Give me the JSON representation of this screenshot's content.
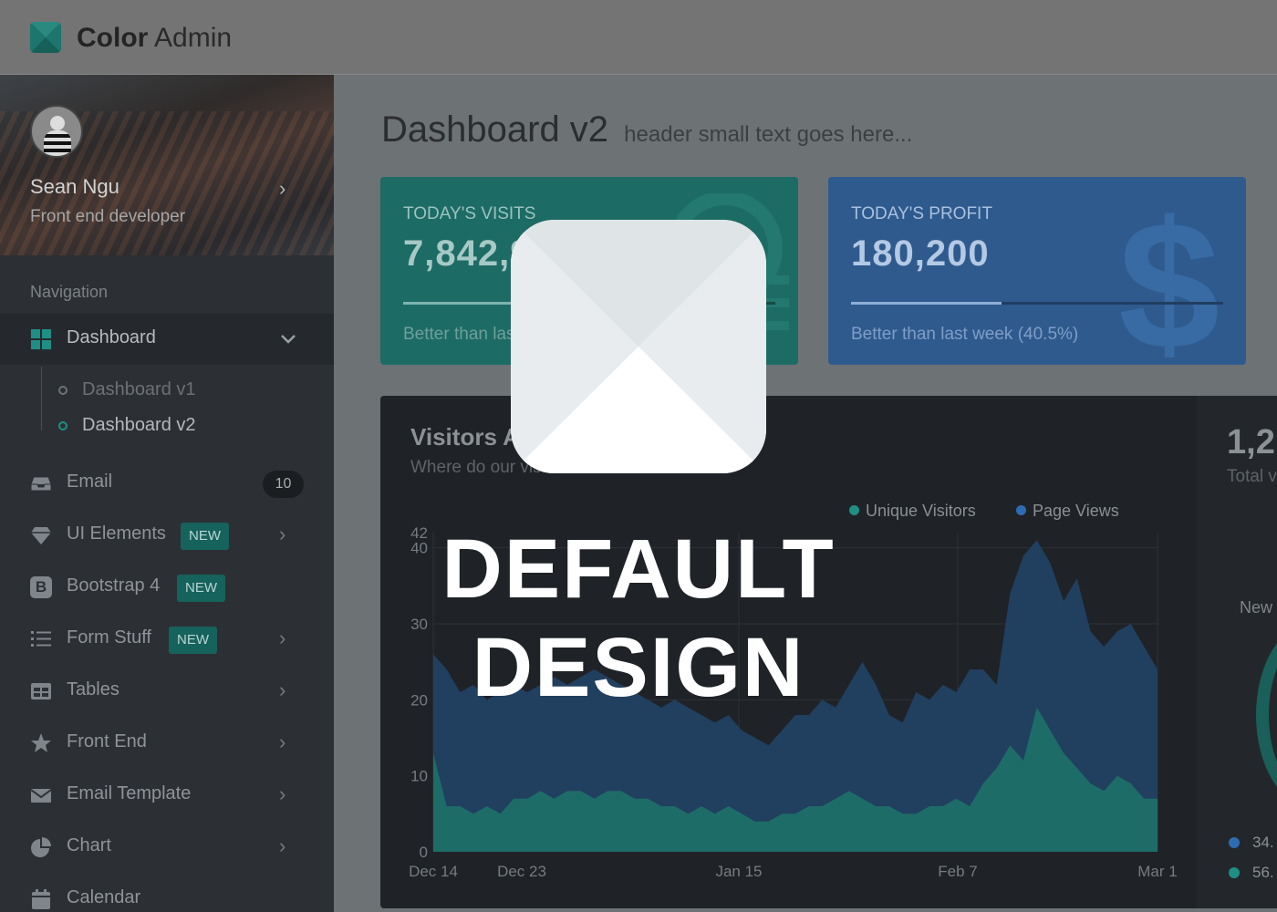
{
  "app": {
    "brand_bold": "Color",
    "brand_light": "Admin"
  },
  "profile": {
    "name": "Sean Ngu",
    "role": "Front end developer"
  },
  "sidebar": {
    "nav_header": "Navigation",
    "items": [
      {
        "label": "Dashboard",
        "icon": "dashboard-grid-icon"
      },
      {
        "label": "Email",
        "icon": "inbox-icon",
        "count": "10"
      },
      {
        "label": "UI Elements",
        "icon": "gem-icon",
        "badge": "NEW"
      },
      {
        "label": "Bootstrap 4",
        "icon": "bootstrap-icon",
        "badge": "NEW"
      },
      {
        "label": "Form Stuff",
        "icon": "list-icon",
        "badge": "NEW"
      },
      {
        "label": "Tables",
        "icon": "table-icon"
      },
      {
        "label": "Front End",
        "icon": "star-icon"
      },
      {
        "label": "Email Template",
        "icon": "envelope-icon"
      },
      {
        "label": "Chart",
        "icon": "pie-chart-icon"
      },
      {
        "label": "Calendar",
        "icon": "calendar-icon"
      }
    ],
    "sub_items": [
      "Dashboard v1",
      "Dashboard v2"
    ],
    "bootstrap_glyph": "B"
  },
  "page": {
    "title": "Dashboard v2",
    "subtitle": "header small text goes here..."
  },
  "stats": [
    {
      "label": "TODAY'S VISITS",
      "value": "7,842,900",
      "desc": "Better than last week (76.3%)",
      "progress": 0.763,
      "color": "#1d6b65"
    },
    {
      "label": "TODAY'S PROFIT",
      "value": "180,200",
      "desc": "Better than last week (40.5%)",
      "progress": 0.405,
      "color": "#2f5a8e"
    }
  ],
  "panel": {
    "title": "Visitors Analytics",
    "subtitle": "Where do our visitors come from",
    "side_value": "1,2",
    "side_label": "Total v",
    "side_new": "New",
    "side_stats": [
      "34.",
      "56."
    ]
  },
  "chart_data": {
    "type": "area",
    "x": [
      "Dec 14",
      "Dec 23",
      "Jan 15",
      "Feb 7",
      "Mar 1"
    ],
    "y_ticks": [
      0,
      10,
      20,
      30,
      40,
      42
    ],
    "ylim": [
      0,
      42
    ],
    "legend_position": "top-right",
    "series": [
      {
        "name": "Unique Visitors",
        "color": "#1f8f86",
        "values": [
          13,
          6,
          6,
          5,
          6,
          5,
          7,
          7,
          8,
          7,
          8,
          8,
          7,
          8,
          8,
          7,
          7,
          6,
          6,
          5,
          6,
          5,
          6,
          5,
          4,
          4,
          5,
          5,
          6,
          6,
          7,
          8,
          7,
          6,
          6,
          5,
          5,
          6,
          6,
          7,
          6,
          9,
          11,
          14,
          12,
          19,
          16,
          13,
          11,
          9,
          8,
          10,
          9,
          7,
          7
        ]
      },
      {
        "name": "Page Views",
        "color": "#2e6bb3",
        "values": [
          26,
          24,
          21,
          22,
          20,
          21,
          22,
          21,
          22,
          23,
          22,
          23,
          24,
          23,
          22,
          21,
          20,
          19,
          20,
          19,
          18,
          17,
          18,
          16,
          15,
          14,
          16,
          18,
          18,
          20,
          19,
          22,
          25,
          22,
          18,
          17,
          21,
          20,
          22,
          21,
          24,
          24,
          22,
          34,
          39,
          41,
          38,
          33,
          36,
          29,
          27,
          29,
          30,
          27,
          24
        ]
      }
    ]
  },
  "overlay": {
    "line1": "DEFAULT",
    "line2": "DESIGN"
  },
  "colors": {
    "teal": "#1d6b65",
    "blue": "#2f5a8e",
    "sidebar": "#2c3034",
    "header": "#747474"
  }
}
